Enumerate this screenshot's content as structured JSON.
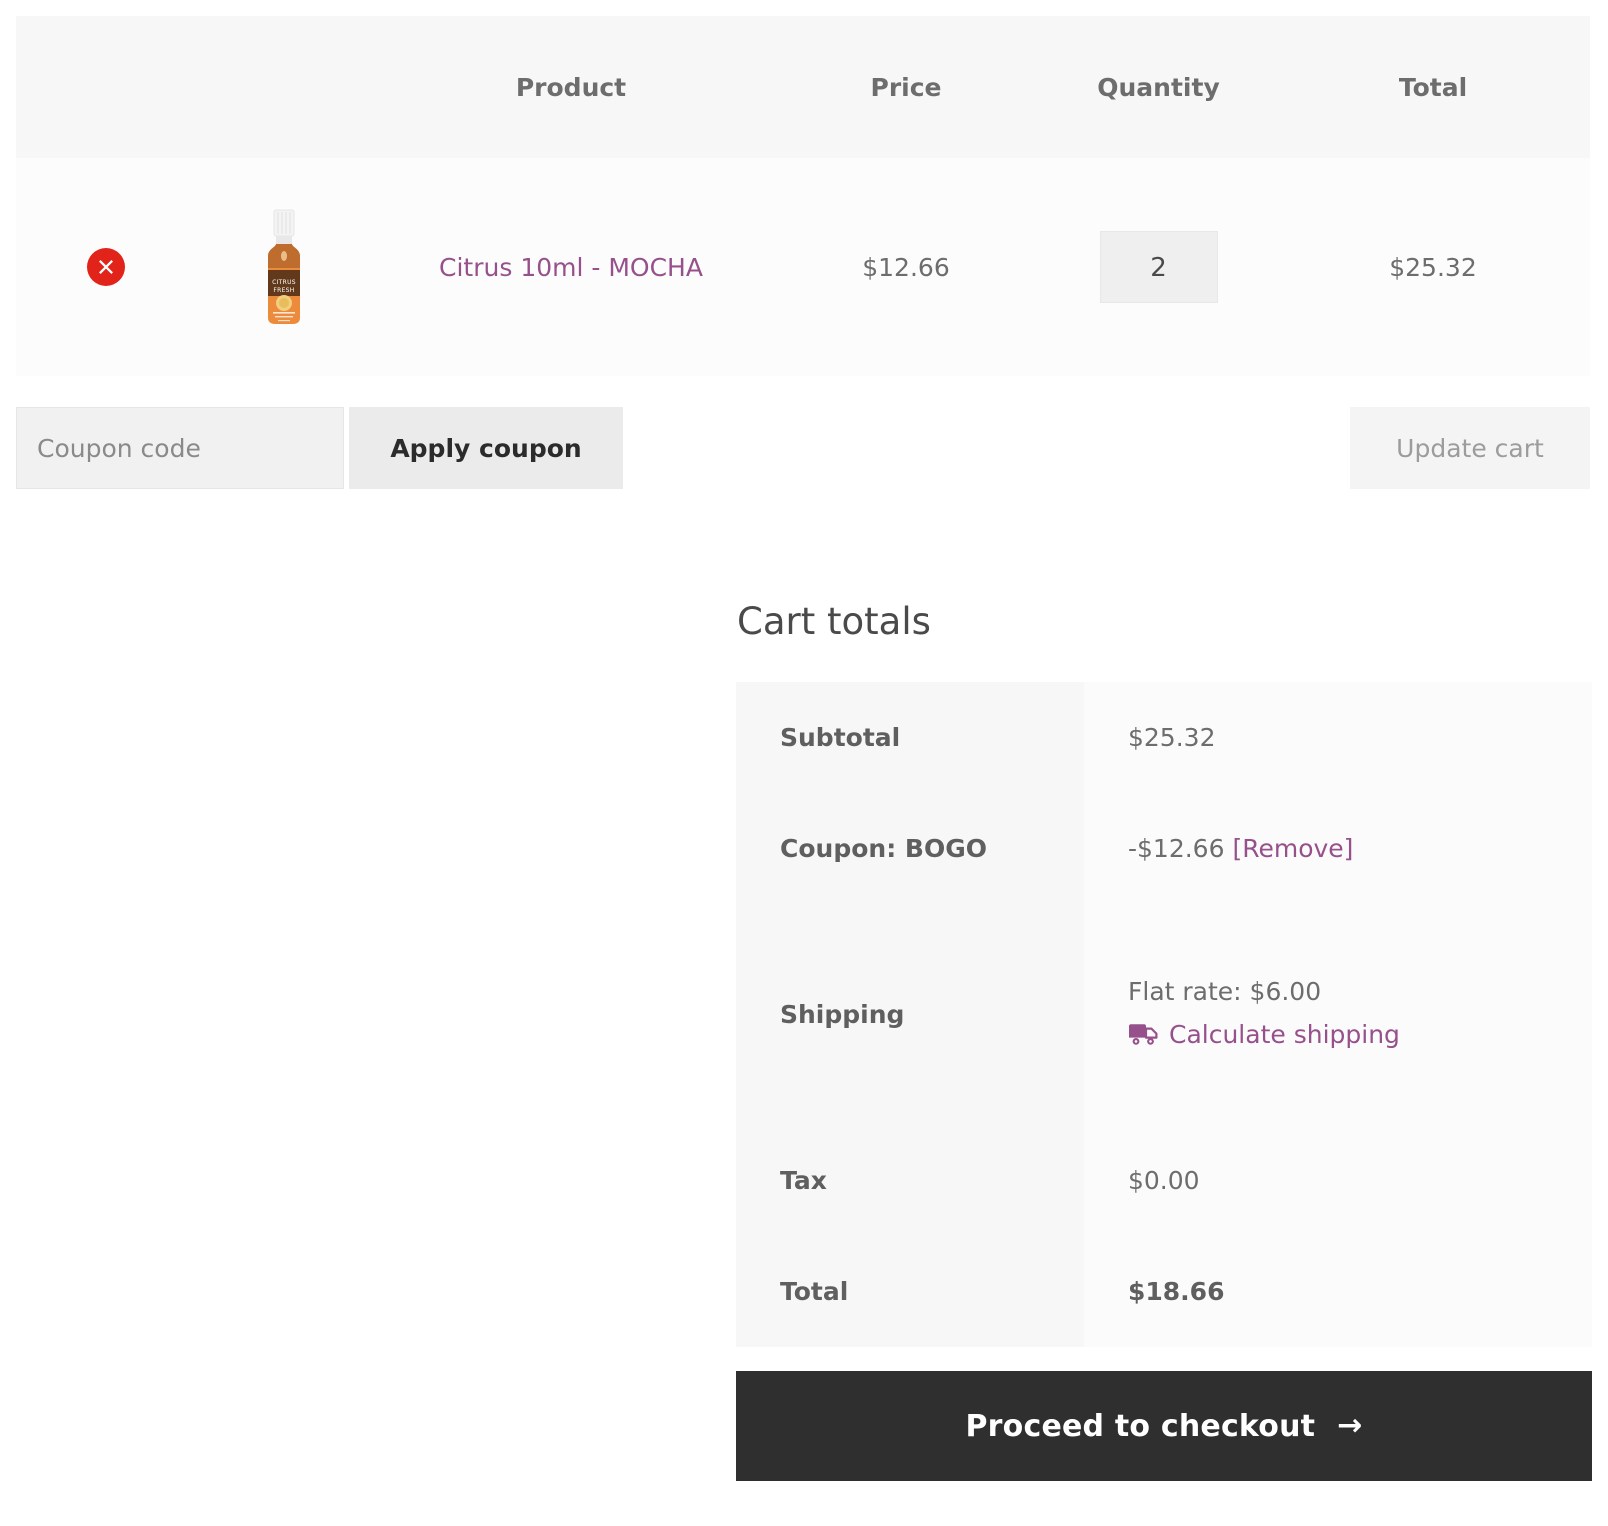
{
  "cart_table": {
    "columns": [
      "",
      "",
      "Product",
      "Price",
      "Quantity",
      "Total"
    ],
    "headers": {
      "product": "Product",
      "price": "Price",
      "quantity": "Quantity",
      "total": "Total"
    },
    "rows": [
      {
        "remove_icon": "remove-circle-icon",
        "thumbnail_alt": "Citrus Fresh essential oil bottle",
        "thumbnail_label": "CITRUS FRESH",
        "product_name": "Citrus 10ml - MOCHA",
        "price": "$12.66",
        "quantity": "2",
        "line_total": "$25.32"
      }
    ]
  },
  "actions": {
    "coupon_placeholder": "Coupon code",
    "coupon_value": "",
    "apply_coupon_label": "Apply coupon",
    "update_cart_label": "Update cart"
  },
  "cart_totals": {
    "title": "Cart totals",
    "rows": [
      {
        "label": "Subtotal",
        "value": "$25.32"
      },
      {
        "label": "Coupon: BOGO",
        "value": "-$12.66",
        "remove_label": "[Remove]"
      },
      {
        "label": "Shipping",
        "value": "Flat rate: $6.00",
        "calculate_label": "Calculate shipping",
        "icon": "truck-icon"
      },
      {
        "label": "Tax",
        "value": "$0.00"
      },
      {
        "label": "Total",
        "value": "$18.66"
      }
    ]
  },
  "checkout": {
    "label": "Proceed to checkout",
    "arrow": "→"
  },
  "colors": {
    "link": "#96518c",
    "remove_button": "#e2231a",
    "checkout_bg": "#2f2f2f",
    "header_bg": "#f7f7f7",
    "row_bg": "#fcfcfc",
    "muted_text": "#6d6d6d"
  }
}
